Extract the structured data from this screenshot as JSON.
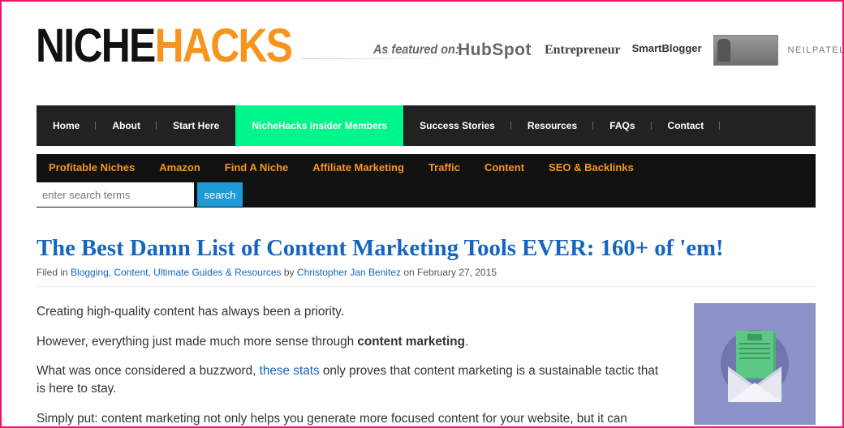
{
  "logo": {
    "part1": "NICHE",
    "part2": "HACKS"
  },
  "featured": {
    "label": "As featured on:",
    "outlets": {
      "hubspot": "HubSpot",
      "entrepreneur": "Entrepreneur",
      "smartblogger": "SmartBlogger",
      "neilpatel": "NEILPATEL"
    }
  },
  "main_nav": [
    {
      "label": "Home"
    },
    {
      "label": "About"
    },
    {
      "label": "Start Here"
    },
    {
      "label": "NicheHacks Insider Members"
    },
    {
      "label": "Success Stories"
    },
    {
      "label": "Resources"
    },
    {
      "label": "FAQs"
    },
    {
      "label": "Contact"
    }
  ],
  "category_nav": [
    {
      "label": "Profitable Niches"
    },
    {
      "label": "Amazon"
    },
    {
      "label": "Find A Niche"
    },
    {
      "label": "Affiliate Marketing"
    },
    {
      "label": "Traffic"
    },
    {
      "label": "Content"
    },
    {
      "label": "SEO & Backlinks"
    }
  ],
  "search": {
    "placeholder": "enter search terms",
    "button": "search"
  },
  "article": {
    "title": "The Best Damn List of Content Marketing Tools EVER: 160+ of 'em!",
    "meta": {
      "filed_in": "Filed in",
      "cat1": "Blogging",
      "cat2": "Content",
      "cat3": "Ultimate Guides & Resources",
      "by": "by",
      "author": "Christopher Jan Benitez",
      "on": "on February 27, 2015"
    },
    "p1": "Creating high-quality content has always been a priority.",
    "p2_before": "However, everything just made much more sense through ",
    "p2_bold": "content marketing",
    "p2_after": ".",
    "p3_before": "What was once considered a buzzword, ",
    "p3_link": "these stats",
    "p3_after": " only proves that content marketing is a sustainable tactic that is here to stay.",
    "p4": "Simply put: content marketing not only helps you generate more focused content for your website, but it can"
  },
  "colors": {
    "accent_orange": "#f7941d",
    "link_blue": "#1565c0",
    "active_nav_green": "#00f58a",
    "frame_pink": "#e8186d",
    "search_button": "#1e9ad6",
    "image_bg": "#8c93c8"
  }
}
